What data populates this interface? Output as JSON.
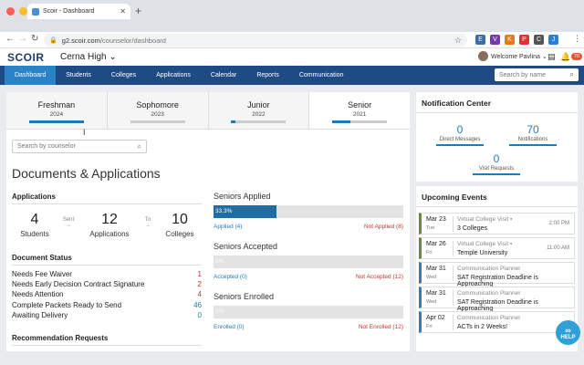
{
  "browser": {
    "tab_title": "Scoir - Dashboard",
    "url_host": "g2.scoir.com",
    "url_path": "/counselor/dashboard",
    "extensions": [
      "E",
      "V",
      "K",
      "P",
      "C",
      "J"
    ]
  },
  "header": {
    "logo": "SCOIR",
    "school": "Cerna High",
    "welcome": "Welcome Pavlina",
    "notification_badge": "70"
  },
  "nav": {
    "items": [
      "Dashboard",
      "Students",
      "Colleges",
      "Applications",
      "Calendar",
      "Reports",
      "Communication"
    ],
    "active": "Dashboard",
    "search_placeholder": "Search by name"
  },
  "grades": [
    {
      "name": "Freshman",
      "year": "2024",
      "progress": 1.0
    },
    {
      "name": "Sophomore",
      "year": "2023",
      "progress": 0.0
    },
    {
      "name": "Junior",
      "year": "2022",
      "progress": 0.08
    },
    {
      "name": "Senior",
      "year": "2021",
      "progress": 0.333
    }
  ],
  "main": {
    "counselor_placeholder": "Search by counselor",
    "title": "Documents & Applications",
    "applications": {
      "heading": "Applications",
      "students": {
        "num": "4",
        "label": "Students"
      },
      "sent": "Sent",
      "apps": {
        "num": "12",
        "label": "Applications"
      },
      "to": "To",
      "colleges": {
        "num": "10",
        "label": "Colleges"
      }
    },
    "document_status": {
      "heading": "Document Status",
      "rows": [
        {
          "label": "Needs Fee Waiver",
          "value": "1"
        },
        {
          "label": "Needs Early Decision Contract Signature",
          "value": "2"
        },
        {
          "label": "Needs Attention",
          "value": "4"
        },
        {
          "label": "Complete Packets Ready to Send",
          "value": "46"
        },
        {
          "label": "Awaiting Delivery",
          "value": "0"
        }
      ]
    },
    "recommendation_heading": "Recommendation Requests",
    "seniors": [
      {
        "title": "Seniors Applied",
        "percent_label": "33.3%",
        "fraction": 0.333,
        "yes": "Applied (4)",
        "no": "Not Applied (8)"
      },
      {
        "title": "Seniors Accepted",
        "percent_label": "0%",
        "fraction": 0.0,
        "yes": "Accepted (0)",
        "no": "Not Accepted (12)"
      },
      {
        "title": "Seniors Enrolled",
        "percent_label": "0%",
        "fraction": 0.0,
        "yes": "Enrolled (0)",
        "no": "Not Enrolled (12)"
      }
    ]
  },
  "notifications": {
    "title": "Notification Center",
    "direct": {
      "num": "0",
      "label": "Direct Messages"
    },
    "notif": {
      "num": "70",
      "label": "Notifications"
    },
    "visits": {
      "num": "0",
      "label": "Visit Requests"
    }
  },
  "events": {
    "title": "Upcoming Events",
    "items": [
      {
        "date": "Mar 23",
        "day": "Tue",
        "type": "Virtual College Visit",
        "name": "3 Colleges",
        "time": "2:00 PM",
        "kind": "visit"
      },
      {
        "date": "Mar 26",
        "day": "Fri",
        "type": "Virtual College Visit",
        "name": "Temple University",
        "time": "11:00 AM",
        "kind": "visit"
      },
      {
        "date": "Mar 31",
        "day": "Wed",
        "type": "Communication Planner",
        "name": "SAT Registration Deadline is Approaching",
        "time": "",
        "kind": "planner"
      },
      {
        "date": "Mar 31",
        "day": "Wed",
        "type": "Communication Planner",
        "name": "SAT Registration Deadline is Approaching",
        "time": "",
        "kind": "planner"
      },
      {
        "date": "Apr 02",
        "day": "Fri",
        "type": "Communication Planner",
        "name": "ACTs in 2 Weeks!",
        "time": "",
        "kind": "planner"
      }
    ]
  },
  "help_label": "HELP",
  "colors": {
    "nav": "#1f4b85",
    "active_tab": "#2a83c6",
    "accent": "#1f7ab8",
    "danger": "#c0392b"
  }
}
